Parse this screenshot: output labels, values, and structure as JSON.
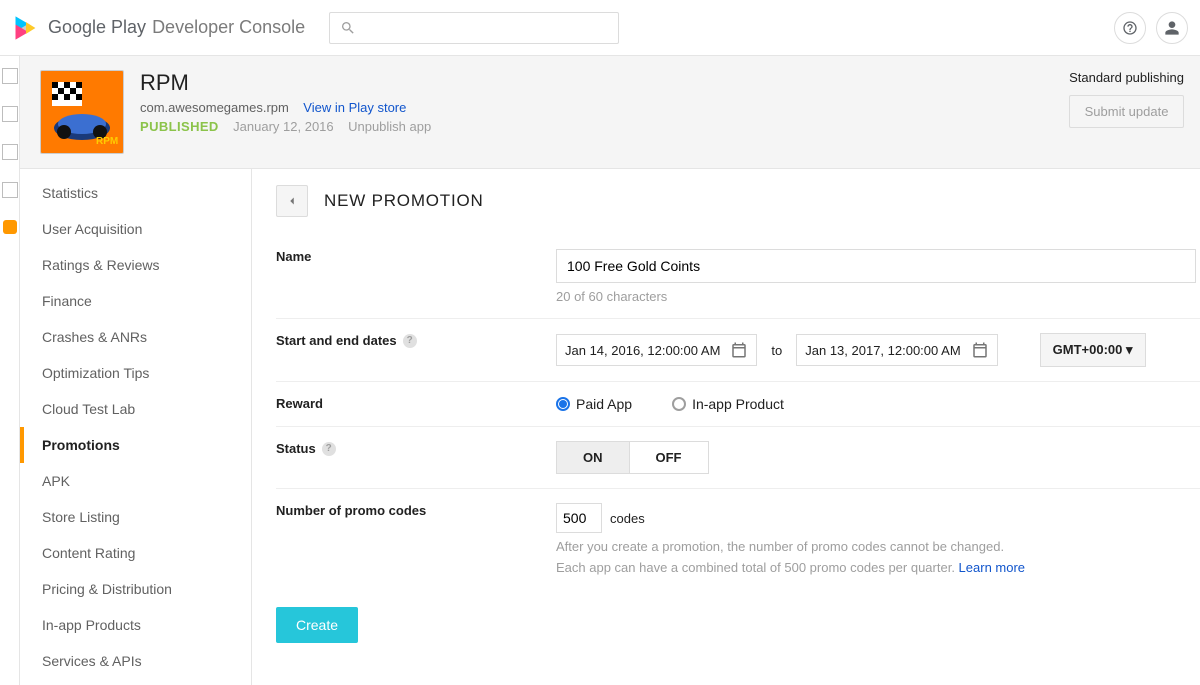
{
  "header": {
    "brand_bold": "Google Play",
    "brand_light": "Developer Console",
    "search_placeholder": ""
  },
  "app": {
    "name": "RPM",
    "package_id": "com.awesomegames.rpm",
    "view_store_link": "View in Play store",
    "status": "PUBLISHED",
    "publish_date": "January 12, 2016",
    "unpublish_label": "Unpublish app",
    "publishing_mode": "Standard publishing",
    "submit_label": "Submit update"
  },
  "sidebar": {
    "items": [
      "Statistics",
      "User Acquisition",
      "Ratings & Reviews",
      "Finance",
      "Crashes & ANRs",
      "Optimization Tips",
      "Cloud Test Lab",
      "Promotions",
      "APK",
      "Store Listing",
      "Content Rating",
      "Pricing & Distribution",
      "In-app Products",
      "Services & APIs"
    ],
    "active_index": 7
  },
  "form": {
    "title": "NEW PROMOTION",
    "name_label": "Name",
    "name_value": "100 Free Gold Coints",
    "name_count": "20 of 60 characters",
    "dates_label": "Start and end dates",
    "start_date": "Jan 14, 2016, 12:00:00 AM",
    "to_label": "to",
    "end_date": "Jan 13, 2017, 12:00:00 AM",
    "timezone": "GMT+00:00  ▾",
    "reward_label": "Reward",
    "reward_paid": "Paid App",
    "reward_iap": "In-app Product",
    "status_label": "Status",
    "status_on": "ON",
    "status_off": "OFF",
    "codes_label": "Number of promo codes",
    "codes_value": "500",
    "codes_suffix": "codes",
    "codes_hint1": "After you create a promotion, the number of promo codes cannot be changed.",
    "codes_hint2a": "Each app can have a combined total of 500 promo codes per quarter. ",
    "codes_learn": "Learn more",
    "create_label": "Create"
  }
}
